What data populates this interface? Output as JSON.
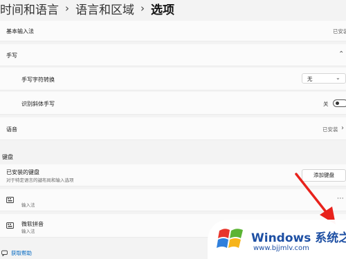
{
  "breadcrumb": {
    "level1": "时间和语言",
    "level2": "语言和区域",
    "current": "选项",
    "separator": "›"
  },
  "rows": {
    "basic_input": {
      "label": "基本输入法",
      "status": "已安装"
    },
    "handwriting": {
      "label": "手写"
    },
    "handwriting_convert": {
      "label": "手写字符转换",
      "value": "无"
    },
    "recognize_handwriting": {
      "label": "识别斜体手写",
      "state": "关"
    },
    "speech": {
      "label": "语音",
      "status": "已安装"
    }
  },
  "keyboard": {
    "section_title": "键盘",
    "installed": {
      "label": "已安装的键盘",
      "description": "对于特定语言的键布局和输入选项",
      "add_button": "添加键盘"
    },
    "items": [
      {
        "name": "",
        "type": "输入法",
        "more": "···"
      },
      {
        "name": "微软拼音",
        "type": "输入法"
      }
    ]
  },
  "footer": {
    "help_link": "获取帮助"
  },
  "watermark": {
    "brand": "Windows",
    "brand_cn": "系统之家",
    "url": "www.bjjmlv.com"
  },
  "colors": {
    "accent": "#0067c0",
    "arrow": "#e8221c",
    "background": "#f3f3f3",
    "card": "#fbfbfb"
  }
}
